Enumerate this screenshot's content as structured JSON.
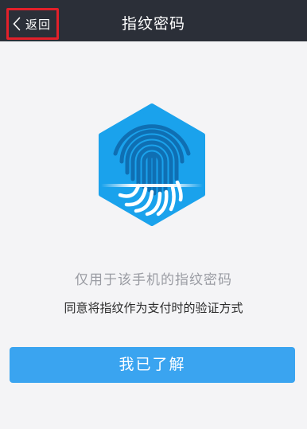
{
  "nav": {
    "back_label": "返回",
    "title": "指纹密码"
  },
  "main": {
    "hint": "仅用于该手机的指纹密码",
    "consent": "同意将指纹作为支付时的验证方式",
    "confirm_label": "我已了解"
  },
  "icons": {
    "back": "chevron-left-icon",
    "fingerprint": "fingerprint-icon"
  },
  "colors": {
    "nav_background": "#2b2f38",
    "accent": "#3aa4f0",
    "hexagon": "#1aa2ec",
    "highlight_border": "#e3202a"
  }
}
